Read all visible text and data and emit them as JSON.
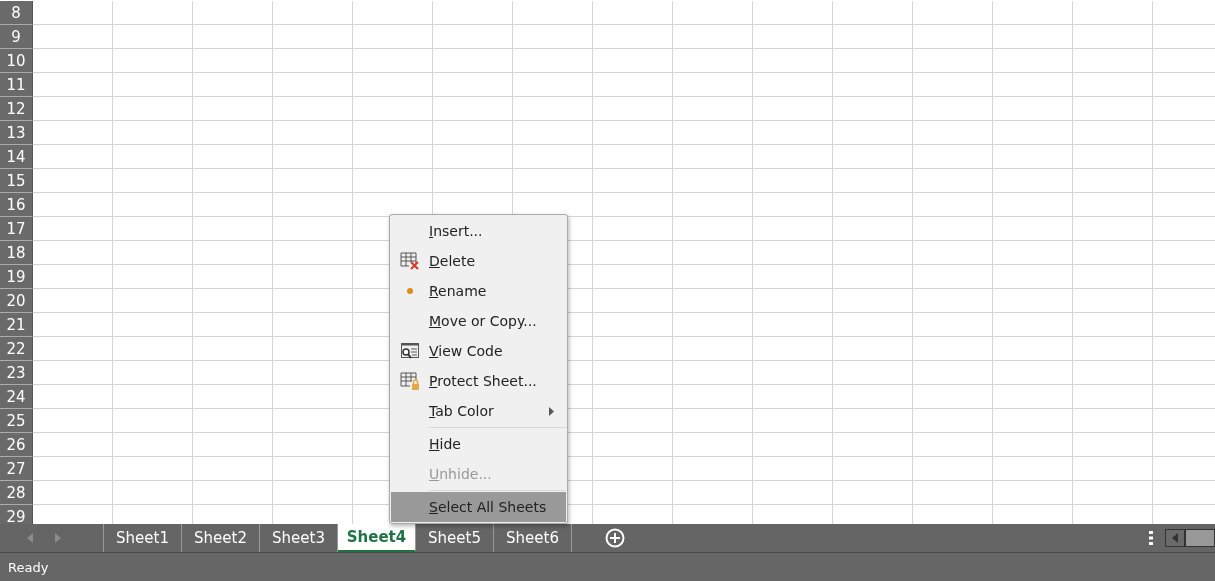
{
  "row_headers": [
    "8",
    "9",
    "10",
    "11",
    "12",
    "13",
    "14",
    "15",
    "16",
    "17",
    "18",
    "19",
    "20",
    "21",
    "22",
    "23",
    "24",
    "25",
    "26",
    "27",
    "28",
    "29"
  ],
  "sheet_tabs": [
    {
      "label": "Sheet1",
      "selected": false
    },
    {
      "label": "Sheet2",
      "selected": false
    },
    {
      "label": "Sheet3",
      "selected": false
    },
    {
      "label": "Sheet4",
      "selected": true
    },
    {
      "label": "Sheet5",
      "selected": false
    },
    {
      "label": "Sheet6",
      "selected": false
    }
  ],
  "context_menu": [
    {
      "label": "Insert...",
      "kind": "plain",
      "disabled": false,
      "highlighted": false
    },
    {
      "label": "Delete",
      "kind": "delete",
      "disabled": false,
      "highlighted": false
    },
    {
      "label": "Rename",
      "kind": "dot",
      "disabled": false,
      "highlighted": false
    },
    {
      "label": "Move or Copy...",
      "kind": "plain",
      "disabled": false,
      "highlighted": false
    },
    {
      "label": "View Code",
      "kind": "code",
      "disabled": false,
      "highlighted": false
    },
    {
      "label": "Protect Sheet...",
      "kind": "lock",
      "disabled": false,
      "highlighted": false
    },
    {
      "label": "Tab Color",
      "kind": "plain",
      "submenu": true,
      "separator_after": true,
      "disabled": false,
      "highlighted": false
    },
    {
      "label": "Hide",
      "kind": "plain",
      "disabled": false,
      "highlighted": false
    },
    {
      "label": "Unhide...",
      "kind": "plain",
      "separator_after": true,
      "disabled": true,
      "highlighted": false
    },
    {
      "label": "Select All Sheets",
      "kind": "plain",
      "disabled": false,
      "highlighted": true
    }
  ],
  "status_bar": {
    "text": "Ready"
  }
}
